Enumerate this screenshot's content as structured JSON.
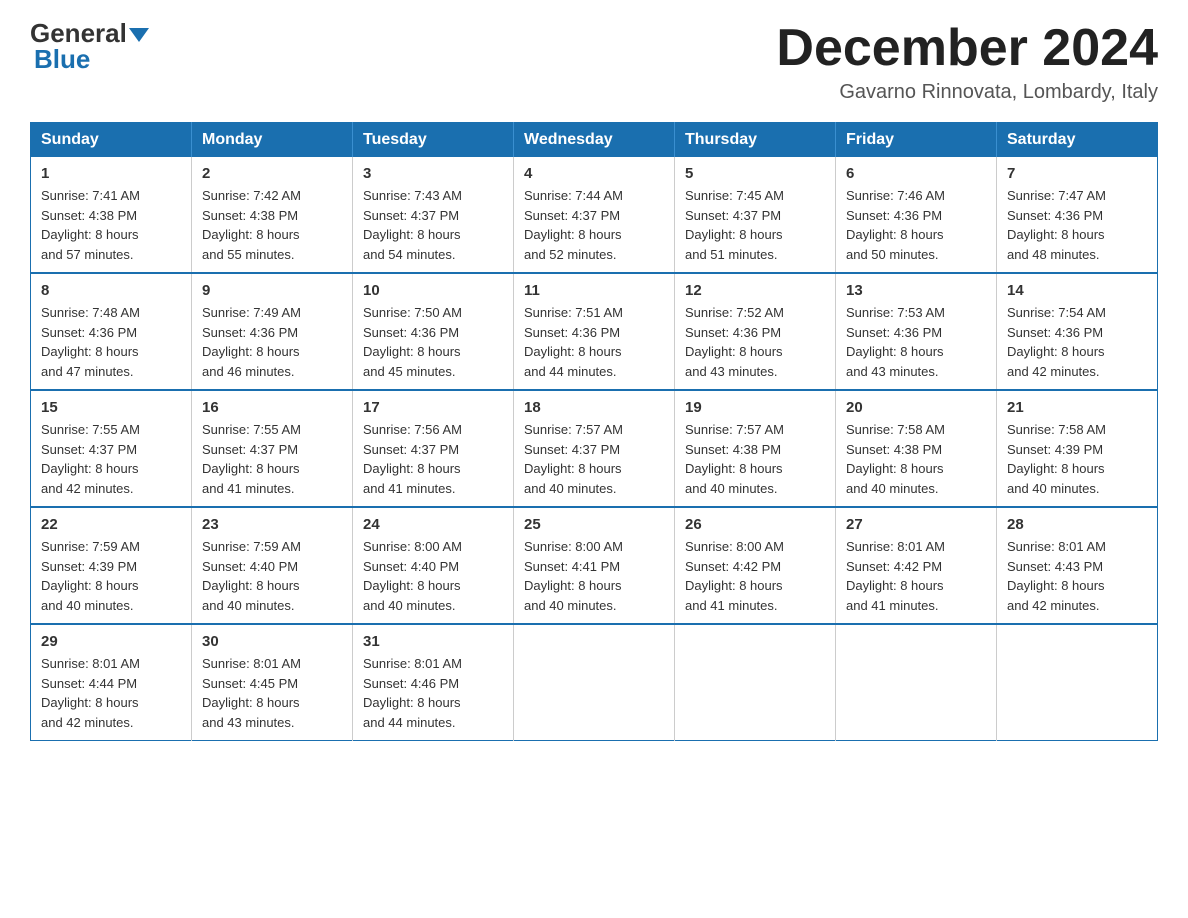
{
  "logo": {
    "general": "General",
    "blue": "Blue"
  },
  "title": "December 2024",
  "subtitle": "Gavarno Rinnovata, Lombardy, Italy",
  "days_of_week": [
    "Sunday",
    "Monday",
    "Tuesday",
    "Wednesday",
    "Thursday",
    "Friday",
    "Saturday"
  ],
  "weeks": [
    [
      {
        "day": "1",
        "sunrise": "7:41 AM",
        "sunset": "4:38 PM",
        "daylight": "8 hours and 57 minutes."
      },
      {
        "day": "2",
        "sunrise": "7:42 AM",
        "sunset": "4:38 PM",
        "daylight": "8 hours and 55 minutes."
      },
      {
        "day": "3",
        "sunrise": "7:43 AM",
        "sunset": "4:37 PM",
        "daylight": "8 hours and 54 minutes."
      },
      {
        "day": "4",
        "sunrise": "7:44 AM",
        "sunset": "4:37 PM",
        "daylight": "8 hours and 52 minutes."
      },
      {
        "day": "5",
        "sunrise": "7:45 AM",
        "sunset": "4:37 PM",
        "daylight": "8 hours and 51 minutes."
      },
      {
        "day": "6",
        "sunrise": "7:46 AM",
        "sunset": "4:36 PM",
        "daylight": "8 hours and 50 minutes."
      },
      {
        "day": "7",
        "sunrise": "7:47 AM",
        "sunset": "4:36 PM",
        "daylight": "8 hours and 48 minutes."
      }
    ],
    [
      {
        "day": "8",
        "sunrise": "7:48 AM",
        "sunset": "4:36 PM",
        "daylight": "8 hours and 47 minutes."
      },
      {
        "day": "9",
        "sunrise": "7:49 AM",
        "sunset": "4:36 PM",
        "daylight": "8 hours and 46 minutes."
      },
      {
        "day": "10",
        "sunrise": "7:50 AM",
        "sunset": "4:36 PM",
        "daylight": "8 hours and 45 minutes."
      },
      {
        "day": "11",
        "sunrise": "7:51 AM",
        "sunset": "4:36 PM",
        "daylight": "8 hours and 44 minutes."
      },
      {
        "day": "12",
        "sunrise": "7:52 AM",
        "sunset": "4:36 PM",
        "daylight": "8 hours and 43 minutes."
      },
      {
        "day": "13",
        "sunrise": "7:53 AM",
        "sunset": "4:36 PM",
        "daylight": "8 hours and 43 minutes."
      },
      {
        "day": "14",
        "sunrise": "7:54 AM",
        "sunset": "4:36 PM",
        "daylight": "8 hours and 42 minutes."
      }
    ],
    [
      {
        "day": "15",
        "sunrise": "7:55 AM",
        "sunset": "4:37 PM",
        "daylight": "8 hours and 42 minutes."
      },
      {
        "day": "16",
        "sunrise": "7:55 AM",
        "sunset": "4:37 PM",
        "daylight": "8 hours and 41 minutes."
      },
      {
        "day": "17",
        "sunrise": "7:56 AM",
        "sunset": "4:37 PM",
        "daylight": "8 hours and 41 minutes."
      },
      {
        "day": "18",
        "sunrise": "7:57 AM",
        "sunset": "4:37 PM",
        "daylight": "8 hours and 40 minutes."
      },
      {
        "day": "19",
        "sunrise": "7:57 AM",
        "sunset": "4:38 PM",
        "daylight": "8 hours and 40 minutes."
      },
      {
        "day": "20",
        "sunrise": "7:58 AM",
        "sunset": "4:38 PM",
        "daylight": "8 hours and 40 minutes."
      },
      {
        "day": "21",
        "sunrise": "7:58 AM",
        "sunset": "4:39 PM",
        "daylight": "8 hours and 40 minutes."
      }
    ],
    [
      {
        "day": "22",
        "sunrise": "7:59 AM",
        "sunset": "4:39 PM",
        "daylight": "8 hours and 40 minutes."
      },
      {
        "day": "23",
        "sunrise": "7:59 AM",
        "sunset": "4:40 PM",
        "daylight": "8 hours and 40 minutes."
      },
      {
        "day": "24",
        "sunrise": "8:00 AM",
        "sunset": "4:40 PM",
        "daylight": "8 hours and 40 minutes."
      },
      {
        "day": "25",
        "sunrise": "8:00 AM",
        "sunset": "4:41 PM",
        "daylight": "8 hours and 40 minutes."
      },
      {
        "day": "26",
        "sunrise": "8:00 AM",
        "sunset": "4:42 PM",
        "daylight": "8 hours and 41 minutes."
      },
      {
        "day": "27",
        "sunrise": "8:01 AM",
        "sunset": "4:42 PM",
        "daylight": "8 hours and 41 minutes."
      },
      {
        "day": "28",
        "sunrise": "8:01 AM",
        "sunset": "4:43 PM",
        "daylight": "8 hours and 42 minutes."
      }
    ],
    [
      {
        "day": "29",
        "sunrise": "8:01 AM",
        "sunset": "4:44 PM",
        "daylight": "8 hours and 42 minutes."
      },
      {
        "day": "30",
        "sunrise": "8:01 AM",
        "sunset": "4:45 PM",
        "daylight": "8 hours and 43 minutes."
      },
      {
        "day": "31",
        "sunrise": "8:01 AM",
        "sunset": "4:46 PM",
        "daylight": "8 hours and 44 minutes."
      },
      null,
      null,
      null,
      null
    ]
  ],
  "sunrise_label": "Sunrise:",
  "sunset_label": "Sunset:",
  "daylight_label": "Daylight:"
}
